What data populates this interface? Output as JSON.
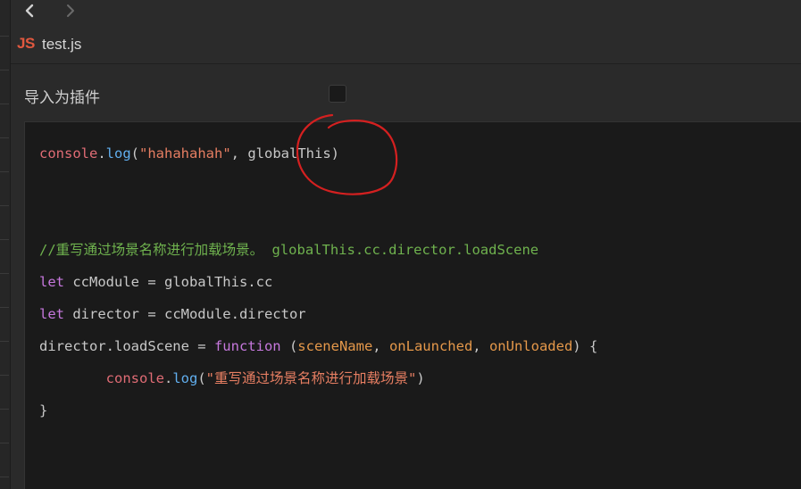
{
  "nav": {
    "back_icon": "chevron-left-icon",
    "forward_icon": "chevron-right-icon"
  },
  "file": {
    "badge": "JS",
    "name": "test.js"
  },
  "property": {
    "label": "导入为插件",
    "checked": false
  },
  "code": {
    "lines": [
      [
        [
          "console",
          "id"
        ],
        [
          ".",
          "txt"
        ],
        [
          "log",
          "fn"
        ],
        [
          "(",
          "txt"
        ],
        [
          "\"hahahahah\"",
          "str"
        ],
        [
          ", globalThis)",
          "txt"
        ]
      ],
      [],
      [],
      [
        [
          "//重写通过场景名称进行加载场景。 globalThis.cc.director.loadScene",
          "com"
        ]
      ],
      [
        [
          "let",
          "kw"
        ],
        [
          " ccModule = globalThis.cc",
          "txt"
        ]
      ],
      [
        [
          "let",
          "kw"
        ],
        [
          " director = ccModule.director",
          "txt"
        ]
      ],
      [
        [
          "director.loadScene = ",
          "txt"
        ],
        [
          "function",
          "kw"
        ],
        [
          " (",
          "txt"
        ],
        [
          "sceneName",
          "par"
        ],
        [
          ", ",
          "txt"
        ],
        [
          "onLaunched",
          "par"
        ],
        [
          ", ",
          "txt"
        ],
        [
          "onUnloaded",
          "par"
        ],
        [
          ") {",
          "txt"
        ]
      ],
      [
        [
          "        ",
          "txt"
        ],
        [
          "console",
          "id"
        ],
        [
          ".",
          "txt"
        ],
        [
          "log",
          "fn"
        ],
        [
          "(",
          "txt"
        ],
        [
          "\"重写通过场景名称进行加载场景\"",
          "str"
        ],
        [
          ")",
          "txt"
        ]
      ],
      [
        [
          "}",
          "txt"
        ]
      ]
    ]
  },
  "colors": {
    "annotation": "#d42020",
    "js_badge": "#e0583f"
  }
}
